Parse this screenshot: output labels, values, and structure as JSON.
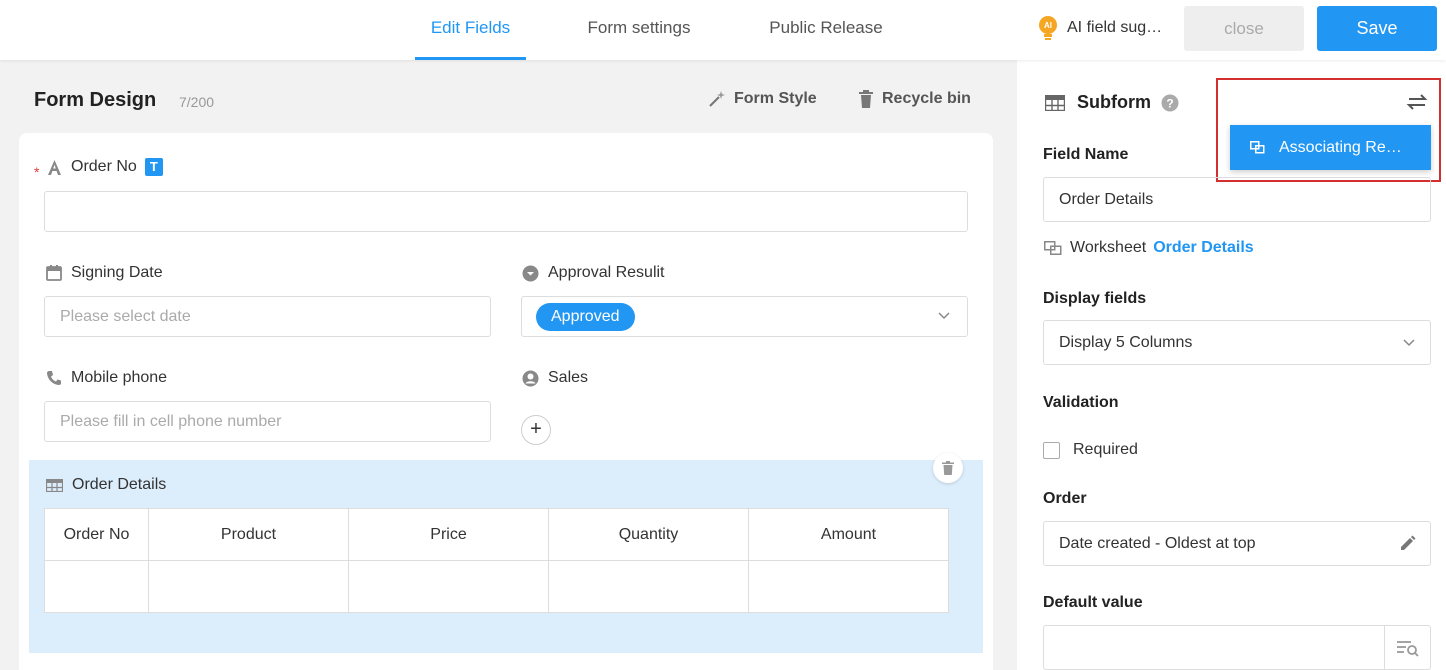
{
  "header": {
    "tabs": [
      {
        "label": "Edit Fields",
        "active": true
      },
      {
        "label": "Form settings",
        "active": false
      },
      {
        "label": "Public Release",
        "active": false
      }
    ],
    "ai_suggestion": "AI field sug…",
    "ai_badge": "AI",
    "close_label": "close",
    "save_label": "Save"
  },
  "form": {
    "title": "Form Design",
    "count": "7/200",
    "style_label": "Form Style",
    "recycle_label": "Recycle bin",
    "fields": {
      "order_no": {
        "label": "Order No",
        "badge": "T",
        "required_mark": "*"
      },
      "signing_date": {
        "label": "Signing Date",
        "placeholder": "Please select date"
      },
      "approval_result": {
        "label": "Approval Resulit",
        "value": "Approved"
      },
      "mobile_phone": {
        "label": "Mobile phone",
        "placeholder": "Please fill in cell phone number"
      },
      "sales": {
        "label": "Sales",
        "add": "+"
      }
    },
    "subform": {
      "label": "Order Details",
      "columns": [
        "Order No",
        "Product",
        "Price",
        "Quantity",
        "Amount"
      ]
    }
  },
  "panel": {
    "title": "Subform",
    "help": "?",
    "field_name_label": "Field Name",
    "field_name_value": "Order Details",
    "worksheet_label": "Worksheet",
    "worksheet_link": "Order Details",
    "display_fields_label": "Display fields",
    "display_fields_value": "Display 5 Columns",
    "validation_label": "Validation",
    "required_label": "Required",
    "order_label": "Order",
    "order_value": "Date created - Oldest at top",
    "default_value_label": "Default value",
    "dropdown_option": "Associating Re…"
  },
  "colors": {
    "accent": "#2196f3",
    "highlight": "#d32f2f",
    "subform_bg": "#dcedfc"
  }
}
